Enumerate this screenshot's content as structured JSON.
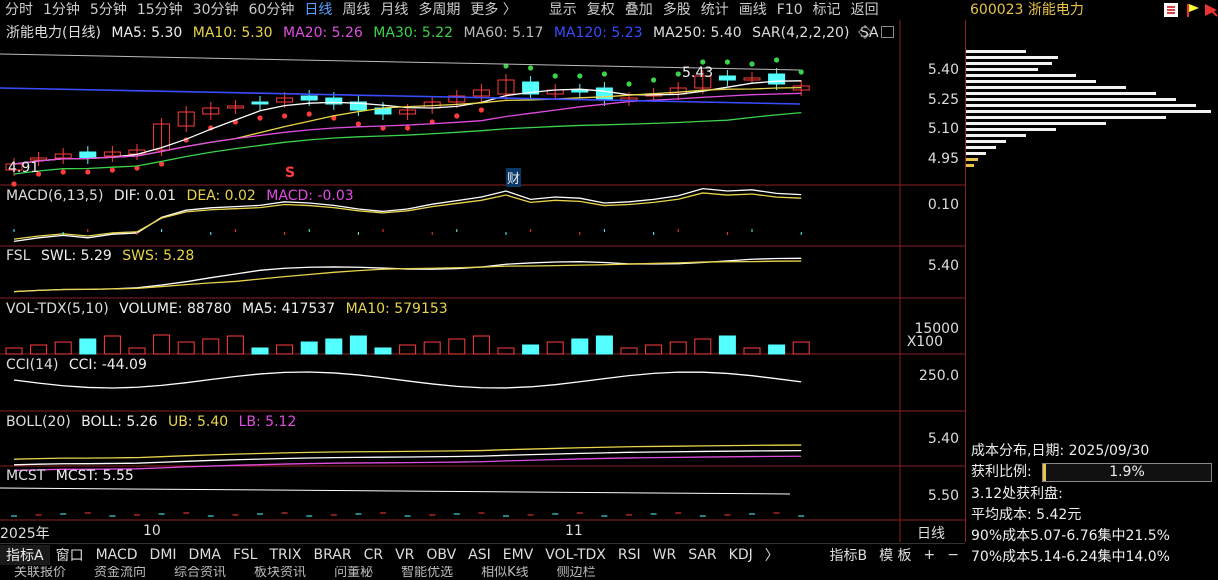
{
  "toolbar": {
    "left": [
      {
        "label": "分时"
      },
      {
        "label": "1分钟"
      },
      {
        "label": "5分钟"
      },
      {
        "label": "15分钟"
      },
      {
        "label": "30分钟"
      },
      {
        "label": "60分钟"
      },
      {
        "label": "日线",
        "active": true
      },
      {
        "label": "周线"
      },
      {
        "label": "月线"
      },
      {
        "label": "多周期"
      },
      {
        "label": "更多 〉"
      }
    ],
    "right": [
      {
        "label": "显示"
      },
      {
        "label": "复权"
      },
      {
        "label": "叠加"
      },
      {
        "label": "多股"
      },
      {
        "label": "统计"
      },
      {
        "label": "画线"
      },
      {
        "label": "F10"
      },
      {
        "label": "标记"
      },
      {
        "label": "返回"
      }
    ],
    "stock": "600023 浙能电力",
    "accent": "#5aa0ff"
  },
  "main_legend": {
    "title": "浙能电力(日线)",
    "ma5": "MA5: 5.30",
    "ma10": "MA10: 5.30",
    "ma20": "MA20: 5.26",
    "ma30": "MA30: 5.22",
    "ma60": "MA60: 5.17",
    "ma120": "MA120: 5.23",
    "ma250": "MA250: 5.40",
    "sar": "SAR(4,2,2,20)",
    "sa": "SA",
    "high_label": "5.43",
    "low_label": "4.91",
    "marker_s": "S",
    "marker_cai": "财",
    "y_ticks": [
      "5.40",
      "5.25",
      "5.10",
      "4.95"
    ]
  },
  "panels": {
    "macd": {
      "name": "MACD(6,13,5)",
      "dif": "DIF: 0.01",
      "dea": "DEA: 0.02",
      "macd": "MACD: -0.03",
      "tick": "0.10"
    },
    "fsl": {
      "name": "FSL",
      "swl": "SWL: 5.29",
      "sws": "SWS: 5.28",
      "tick": "5.40"
    },
    "vol": {
      "name": "VOL-TDX(5,10)",
      "volume": "VOLUME: 88780",
      "ma5": "MA5: 417537",
      "ma10": "MA10: 579153",
      "tick": "15000",
      "unit": "X100"
    },
    "cci": {
      "name": "CCI(14)",
      "cci": "CCI: -44.09",
      "tick": "250.0"
    },
    "boll": {
      "name": "BOLL(20)",
      "boll": "BOLL: 5.26",
      "ub": "UB: 5.40",
      "lb": "LB: 5.12",
      "tick": "5.40"
    },
    "mcst": {
      "name": "MCST",
      "mcst": "MCST: 5.55",
      "tick": "5.50"
    }
  },
  "x_axis": {
    "labels": [
      "2025年",
      "10",
      "11"
    ],
    "period": "日线"
  },
  "bottom_tabs": {
    "left": [
      "指标A",
      "窗口",
      "MACD",
      "DMI",
      "DMA",
      "FSL",
      "TRIX",
      "BRAR",
      "CR",
      "VR",
      "OBV",
      "ASI",
      "EMV",
      "VOL-TDX",
      "RSI",
      "WR",
      "SAR",
      "KDJ",
      "〉"
    ],
    "right": [
      "指标B",
      "模 板",
      "+",
      "−"
    ]
  },
  "bottom_bar2": [
    "关联报价",
    "资金流向",
    "综合资讯",
    "板块资讯",
    "问董秘",
    "智能优选",
    "相似K线",
    "侧边栏"
  ],
  "cost_panel": {
    "title": "成本分布,日期:  2025/09/30",
    "profit_label": "获利比例:",
    "profit_value": "1.9%",
    "profit_fraction": 0.019,
    "line3": "3.12处获利盘:",
    "line4": "平均成本:  5.42元",
    "line5": "90%成本5.07-6.76集中21.5%",
    "line6": "70%成本5.14-6.24集中14.0%"
  },
  "colors": {
    "up": "#ff3c3c",
    "down": "#54ffff",
    "white": "#ffffff",
    "yellow": "#e8d44a",
    "magenta": "#e04ce0",
    "green": "#3cd24a",
    "blue": "#3a4cff",
    "frame": "#8a1f1f"
  }
}
